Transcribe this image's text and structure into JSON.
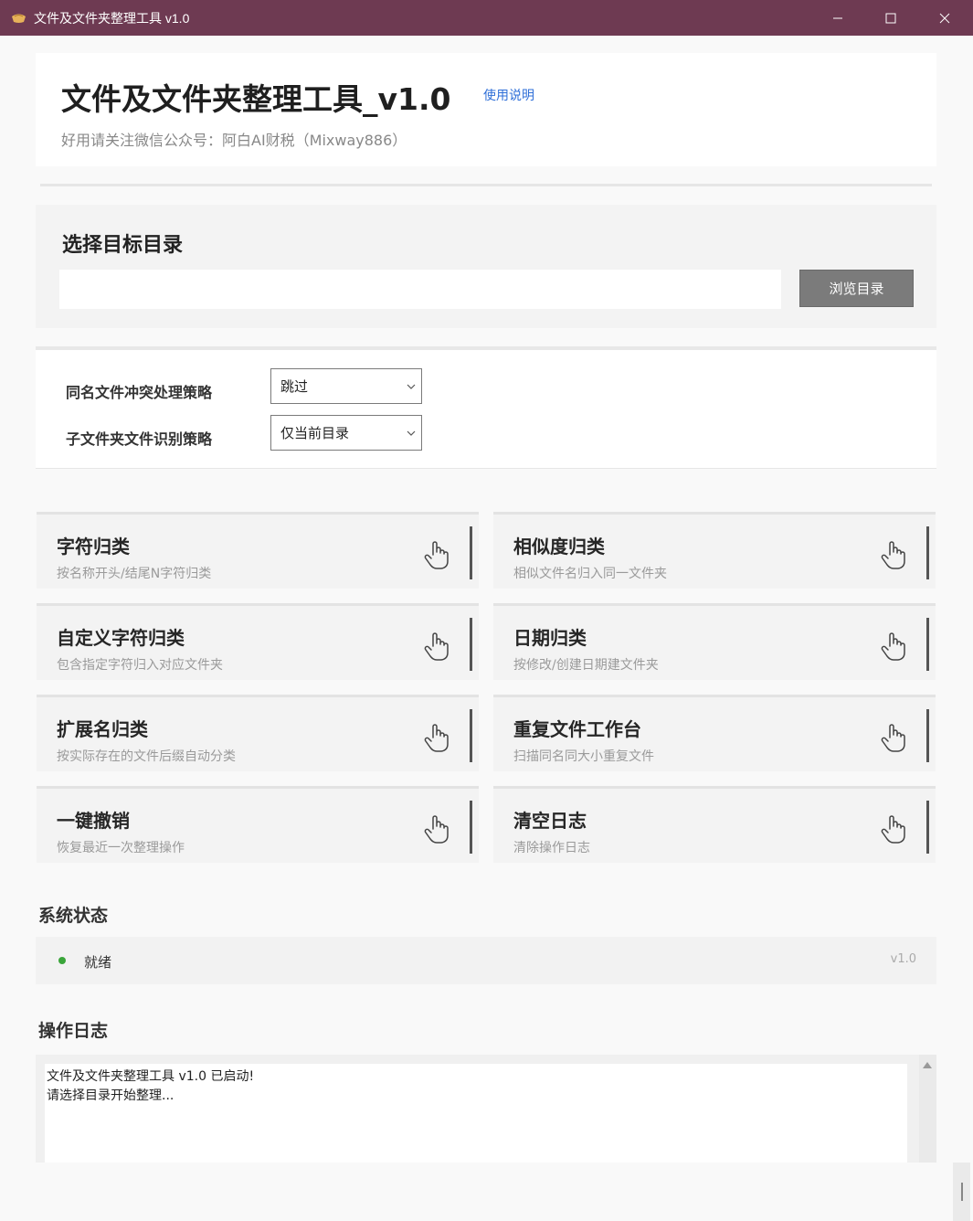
{
  "window": {
    "title": "文件及文件夹整理工具 v1.0",
    "icons": [
      "app-icon",
      "minimize-icon",
      "maximize-icon",
      "close-icon"
    ]
  },
  "header": {
    "title": "文件及文件夹整理工具_v1.0",
    "help_link": "使用说明",
    "subtitle": "好用请关注微信公众号：阿白AI财税（Mixway886）"
  },
  "directory": {
    "title": "选择目标目录",
    "input_value": "",
    "browse_label": "浏览目录"
  },
  "options": [
    {
      "label": "同名文件冲突处理策略",
      "value": "跳过"
    },
    {
      "label": "子文件夹文件识别策略",
      "value": "仅当前目录"
    }
  ],
  "actions": [
    {
      "title": "字符归类",
      "desc": "按名称开头/结尾N字符归类",
      "icon": "hand-pointer-icon"
    },
    {
      "title": "相似度归类",
      "desc": "相似文件名归入同一文件夹",
      "icon": "hand-pointer-icon"
    },
    {
      "title": "自定义字符归类",
      "desc": "包含指定字符归入对应文件夹",
      "icon": "hand-pointer-icon"
    },
    {
      "title": "日期归类",
      "desc": "按修改/创建日期建文件夹",
      "icon": "hand-pointer-icon"
    },
    {
      "title": "扩展名归类",
      "desc": "按实际存在的文件后缀自动分类",
      "icon": "hand-pointer-icon"
    },
    {
      "title": "重复文件工作台",
      "desc": "扫描同名同大小重复文件",
      "icon": "hand-pointer-icon"
    },
    {
      "title": "一键撤销",
      "desc": "恢复最近一次整理操作",
      "icon": "hand-pointer-icon"
    },
    {
      "title": "清空日志",
      "desc": "清除操作日志",
      "icon": "hand-pointer-icon"
    }
  ],
  "status": {
    "section_title": "系统状态",
    "text": "就绪",
    "version": "v1.0",
    "dot_color": "#3aa53a"
  },
  "log": {
    "section_title": "操作日志",
    "lines": [
      "文件及文件夹整理工具 v1.0 已启动!",
      "请选择目录开始整理..."
    ]
  },
  "colors": {
    "titlebar": "#6e3a52",
    "link": "#2f6fd8",
    "button": "#7b7b7b"
  }
}
